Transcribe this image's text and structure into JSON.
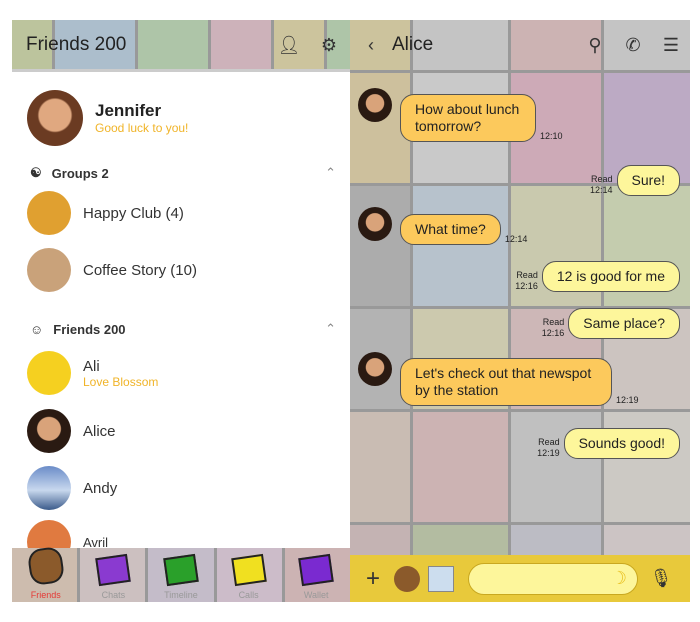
{
  "friends_panel": {
    "title": "Friends 200",
    "icons": [
      "add-friend-icon",
      "settings-icon"
    ],
    "profile": {
      "name": "Jennifer",
      "status": "Good luck to you!"
    },
    "groups_header": "Groups 2",
    "groups": [
      {
        "name": "Happy Club (4)"
      },
      {
        "name": "Coffee Story (10)"
      }
    ],
    "friends_header": "Friends 200",
    "friends": [
      {
        "name": "Ali",
        "status": "Love Blossom"
      },
      {
        "name": "Alice",
        "status": ""
      },
      {
        "name": "Andy",
        "status": ""
      },
      {
        "name": "Avril",
        "status": ""
      }
    ],
    "nav": [
      {
        "label": "Friends",
        "active": true
      },
      {
        "label": "Chats"
      },
      {
        "label": "Timeline"
      },
      {
        "label": "Calls"
      },
      {
        "label": "Wallet"
      }
    ]
  },
  "chat_panel": {
    "title": "Alice",
    "icons": [
      "back-icon",
      "search-icon",
      "call-icon",
      "menu-icon"
    ],
    "messages": [
      {
        "dir": "in",
        "text": "How about lunch tomorrow?",
        "time": "12:10"
      },
      {
        "dir": "out",
        "text": "Sure!",
        "read": "Read",
        "time": "12:14"
      },
      {
        "dir": "in",
        "text": "What time?",
        "time": "12:14"
      },
      {
        "dir": "out",
        "text": "12 is good for me",
        "read": "Read",
        "time": "12:16"
      },
      {
        "dir": "out",
        "text": "Same place?",
        "read": "Read",
        "time": "12:16"
      },
      {
        "dir": "in",
        "text": "Let's check out that newspot by the station",
        "time": "12:19"
      },
      {
        "dir": "out",
        "text": "Sounds good!",
        "read": "Read",
        "time": "12:19"
      }
    ],
    "input": {
      "value": "",
      "icons": [
        "plus-icon",
        "sticker-icon",
        "photo-icon",
        "banana-emoji-icon",
        "mic-icon"
      ]
    }
  },
  "colors": {
    "accent": "#f0b429",
    "incoming_bubble": "#fcc95c",
    "outgoing_bubble": "#fdf69b",
    "input_bar": "#e8c93b",
    "active_nav": "#e53935"
  }
}
